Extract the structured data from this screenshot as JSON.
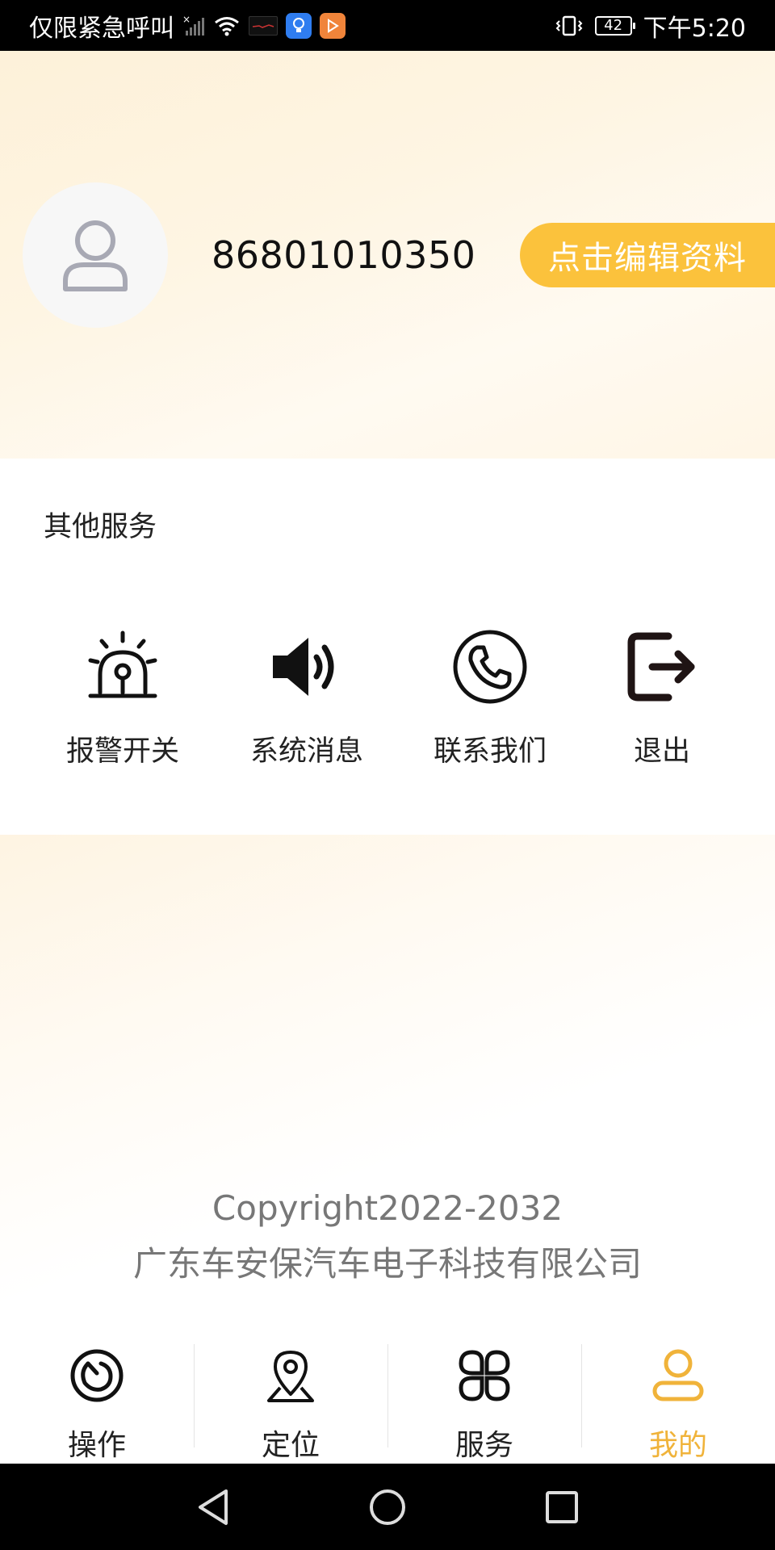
{
  "status_bar": {
    "carrier_text": "仅限紧急呼叫",
    "battery_level": "42",
    "time": "下午5:20",
    "icons": [
      "no-signal-icon",
      "wifi-icon",
      "app-icon",
      "lightbulb-app-icon",
      "play-app-icon",
      "vibrate-icon",
      "battery-icon"
    ]
  },
  "profile": {
    "avatar_icon": "user-icon",
    "phone_number": "86801010350",
    "edit_button_label": "点击编辑资料"
  },
  "services": {
    "title": "其他服务",
    "items": [
      {
        "label": "报警开关",
        "icon": "alarm-siren-icon"
      },
      {
        "label": "系统消息",
        "icon": "speaker-icon"
      },
      {
        "label": "联系我们",
        "icon": "phone-icon"
      },
      {
        "label": "退出",
        "icon": "logout-icon"
      }
    ]
  },
  "footer": {
    "copyright_line": "Copyright2022-2032",
    "company_name": "广东车安保汽车电子科技有限公司"
  },
  "tab_bar": {
    "tabs": [
      {
        "label": "操作",
        "icon": "operate-icon",
        "active": false
      },
      {
        "label": "定位",
        "icon": "location-pin-icon",
        "active": false
      },
      {
        "label": "服务",
        "icon": "services-grid-icon",
        "active": false
      },
      {
        "label": "我的",
        "icon": "profile-icon",
        "active": true
      }
    ],
    "active_color": "#f0b33a"
  },
  "nav_bar": {
    "buttons": [
      "back-icon",
      "home-icon",
      "recents-icon"
    ]
  },
  "colors": {
    "accent": "#fbc23c",
    "header_gradient_start": "#fdf1d9"
  }
}
